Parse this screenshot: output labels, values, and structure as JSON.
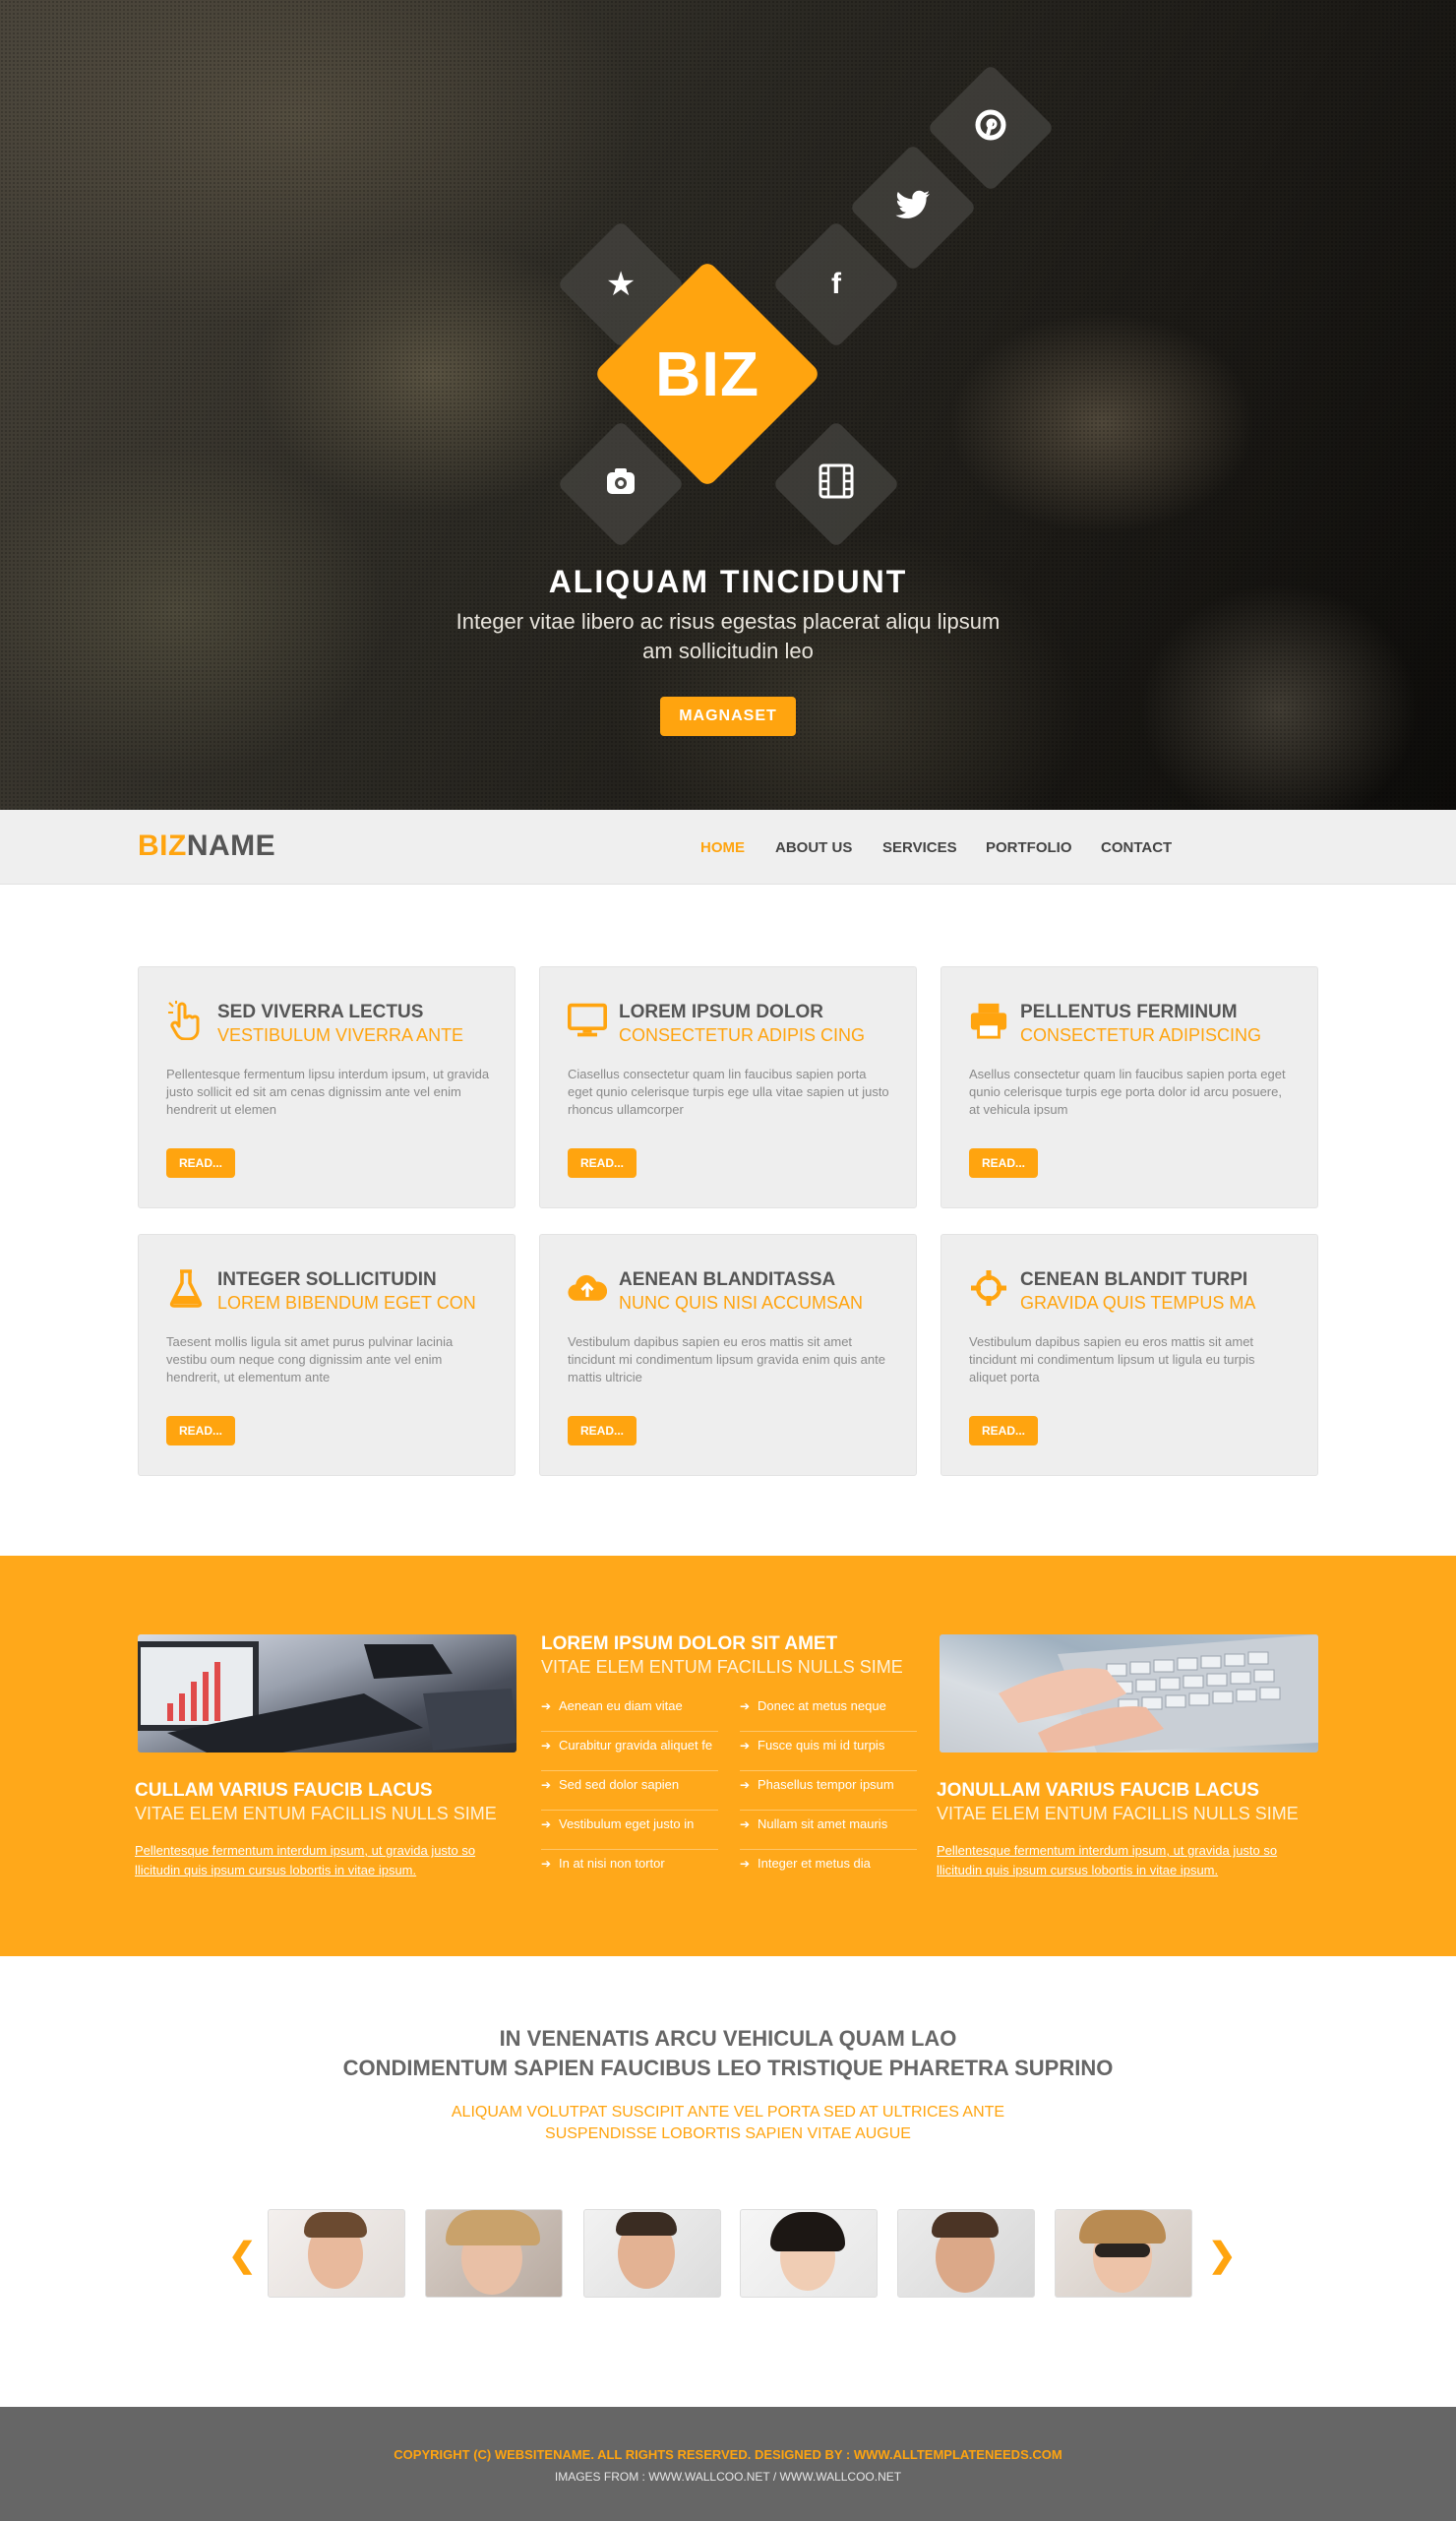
{
  "hero": {
    "logo": "BIZ",
    "title": "ALIQUAM TINCIDUNT",
    "subtitle_line1": "Integer vitae libero ac risus egestas placerat aliqu lipsum",
    "subtitle_line2": "am sollicitudin leo",
    "button": "MAGNASET",
    "social_icons": [
      "star-icon",
      "facebook-icon",
      "twitter-icon",
      "pinterest-icon",
      "camera-icon",
      "film-icon"
    ]
  },
  "nav": {
    "brand_accent": "BIZ",
    "brand_rest": "NAME",
    "items": [
      "HOME",
      "ABOUT US",
      "SERVICES",
      "PORTFOLIO",
      "CONTACT"
    ],
    "active": "HOME"
  },
  "services": [
    {
      "icon": "hand-pointer-icon",
      "title": "SED VIVERRA LECTUS",
      "subtitle": "VESTIBULUM VIVERRA ANTE",
      "body": "Pellentesque fermentum  lipsu interdum ipsum, ut gravida justo sollicit ed sit am cenas dignissim ante vel enim hendrerit ut elemen",
      "button": "READ..."
    },
    {
      "icon": "monitor-icon",
      "title": "LOREM IPSUM DOLOR",
      "subtitle": "CONSECTETUR ADIPIS CING",
      "body": "Ciasellus consectetur quam lin faucibus sapien porta eget  qunio celerisque turpis ege ulla vitae sapien ut justo rhoncus ullamcorper",
      "button": "READ..."
    },
    {
      "icon": "printer-icon",
      "title": "PELLENTUS FERMINUM",
      "subtitle": "CONSECTETUR ADIPISCING",
      "body": "Asellus consectetur quam lin faucibus sapien porta eget  qunio celerisque turpis ege  porta dolor id arcu posuere, at vehicula ipsum",
      "button": "READ..."
    },
    {
      "icon": "flask-icon",
      "title": "INTEGER SOLLICITUDIN",
      "subtitle": "LOREM BIBENDUM EGET CON",
      "body": "Taesent mollis ligula sit amet purus pulvinar lacinia vestibu oum neque cong  dignissim ante vel enim hendrerit, ut elementum ante",
      "button": "READ..."
    },
    {
      "icon": "cloud-upload-icon",
      "title": "AENEAN BLANDITASSA",
      "subtitle": "NUNC QUIS NISI ACCUMSAN",
      "body": "Vestibulum dapibus sapien eu eros mattis sit amet tincidunt mi condimentum lipsum gravida enim quis ante mattis ultricie",
      "button": "READ..."
    },
    {
      "icon": "crosshair-icon",
      "title": "CENEAN BLANDIT TURPI",
      "subtitle": "GRAVIDA QUIS TEMPUS MA",
      "body": "Vestibulum dapibus sapien eu eros mattis sit amet tincidunt mi condimentum lipsum ut ligula eu turpis aliquet porta",
      "button": "READ..."
    }
  ],
  "band": {
    "left": {
      "title": "CULLAM VARIUS FAUCIB LACUS",
      "subtitle": "VITAE ELEM ENTUM FACILLIS NULLS SIME",
      "link": "Pellentesque fermentum interdum ipsum, ut gravida justo so llicitudin quis  ipsum cursus lobortis in vitae ipsum."
    },
    "center": {
      "title": "LOREM IPSUM DOLOR SIT AMET",
      "subtitle": "VITAE ELEM ENTUM FACILLIS NULLS SIME",
      "col1": [
        "Aenean eu diam vitae",
        "Curabitur gravida aliquet fe",
        "Sed sed dolor sapien",
        "Vestibulum eget justo in",
        "In at nisi non tortor"
      ],
      "col2": [
        "Donec at metus neque",
        "Fusce quis mi id turpis",
        "Phasellus tempor ipsum",
        "Nullam sit amet mauris",
        "Integer et metus dia"
      ]
    },
    "right": {
      "title": "JONULLAM VARIUS FAUCIB LACUS",
      "subtitle": "VITAE ELEM ENTUM FACILLIS NULLS SIME",
      "link": "Pellentesque fermentum interdum ipsum, ut gravida justo so llicitudin quis  ipsum cursus lobortis in vitae ipsum."
    }
  },
  "testimonials": {
    "title_line1": "IN VENENATIS ARCU VEHICULA QUAM LAO",
    "title_line2": "CONDIMENTUM SAPIEN FAUCIBUS LEO TRISTIQUE PHARETRA SUPRINO",
    "sub_line1": "ALIQUAM VOLUTPAT SUSCIPIT ANTE VEL PORTA SED AT ULTRICES ANTE",
    "sub_line2": "SUSPENDISSE LOBORTIS SAPIEN VITAE AUGUE",
    "prev": "❮",
    "next": "❯"
  },
  "footer": {
    "line1": "COPYRIGHT (C) WEBSITENAME. ALL RIGHTS RESERVED. DESIGNED BY :  WWW.ALLTEMPLATENEEDS.COM",
    "line2": "IMAGES FROM : WWW.WALLCOO.NET / WWW.WALLCOO.NET"
  },
  "colors": {
    "accent": "#ffa40f",
    "band": "#ffa81a",
    "footer": "#666666",
    "nav": "#efefef"
  }
}
